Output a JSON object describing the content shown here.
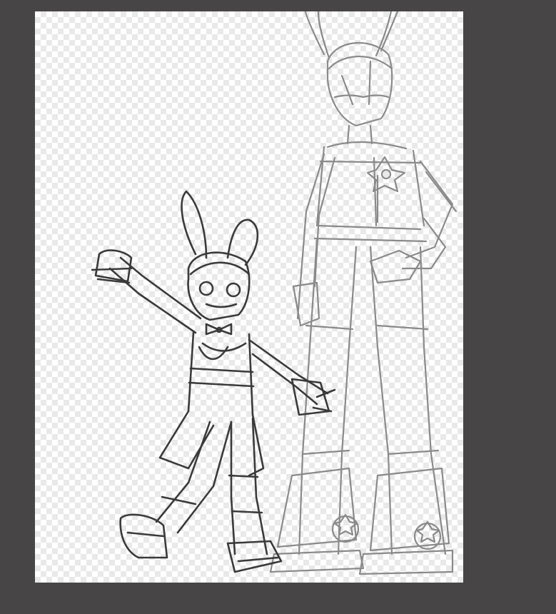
{
  "app": {
    "workspace_color": "#474546",
    "canvas": {
      "background": "transparency-checkerboard",
      "checker_color": "#e9e9e9"
    }
  },
  "artwork": {
    "type": "pencil-sketch",
    "subjects": [
      {
        "name": "small-bunny-character",
        "stroke_color": "#3a3a3a",
        "pose": "waving"
      },
      {
        "name": "tall-bunny-character",
        "stroke_color": "#8a8a8a",
        "pose": "standing"
      }
    ]
  }
}
